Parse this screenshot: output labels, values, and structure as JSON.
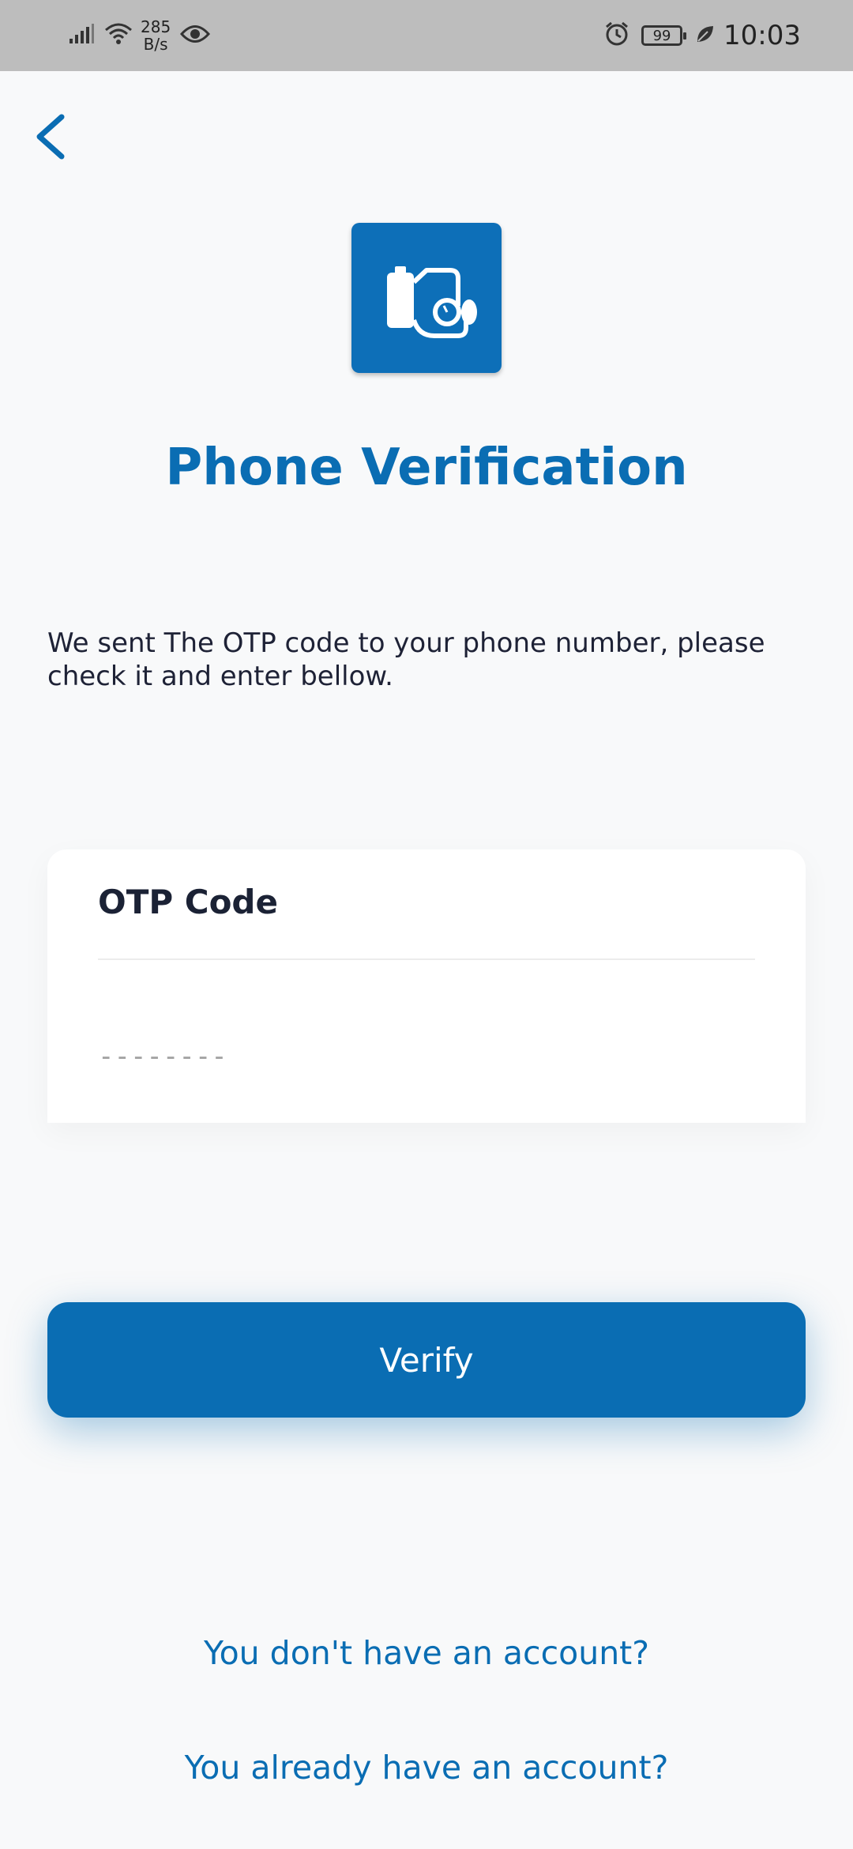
{
  "status_bar": {
    "net_speed_value": "285",
    "net_speed_unit": "B/s",
    "battery_level": "99",
    "time": "10:03"
  },
  "icons": {
    "back": "back-arrow-icon",
    "logo": "blood-pressure-monitor-icon"
  },
  "colors": {
    "primary": "#0a6db3",
    "status_bar_bg": "#bdbdbd",
    "page_bg": "#f8f9fa",
    "text_dark": "#1e2236"
  },
  "page": {
    "title": "Phone Verification",
    "instructions": "We sent The OTP code to your phone number, please check it and enter bellow."
  },
  "otp": {
    "label": "OTP Code",
    "placeholder": "--------",
    "value": ""
  },
  "actions": {
    "verify_label": "Verify",
    "no_account_link": "You don't have an account?",
    "have_account_link": "You already have an account?"
  }
}
